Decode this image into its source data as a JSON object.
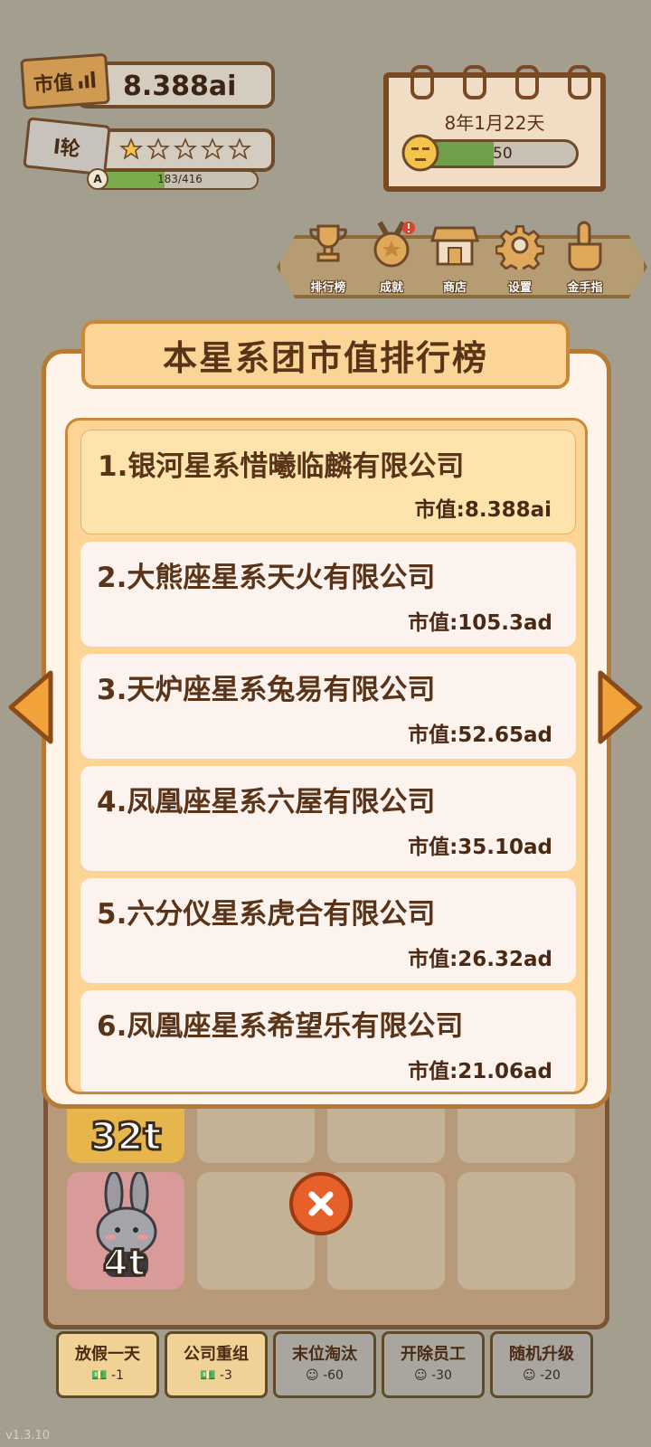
{
  "stats": {
    "market_tag": "市值",
    "market_value": "8.388ai",
    "rank_tag": "l轮",
    "stars_filled": 1,
    "stars_total": 5,
    "level_letter": "A",
    "progress_text": "183/416",
    "progress_ratio": 0.44
  },
  "calendar": {
    "date": "8年1月22天",
    "mood_value": "50",
    "mood_ratio": 0.5
  },
  "toolbar": {
    "ranking": "排行榜",
    "achievement": "成就",
    "shop": "商店",
    "settings": "设置",
    "golden_finger": "金手指"
  },
  "modal": {
    "title": "本星系团市值排行榜",
    "rows": [
      {
        "name": "1.银河星系惜曦临麟有限公司",
        "value": "市值:8.388ai"
      },
      {
        "name": "2.大熊座星系天火有限公司",
        "value": "市值:105.3ad"
      },
      {
        "name": "3.天炉座星系兔易有限公司",
        "value": "市值:52.65ad"
      },
      {
        "name": "4.凤凰座星系六屋有限公司",
        "value": "市值:35.10ad"
      },
      {
        "name": "5.六分仪星系虎合有限公司",
        "value": "市值:26.32ad"
      },
      {
        "name": "6.凤凰座星系希望乐有限公司",
        "value": "市值:21.06ad"
      }
    ]
  },
  "board": {
    "tile1_label": "32t",
    "tile2_label": "4t"
  },
  "actions": [
    {
      "label": "放假一天",
      "cost": "-1"
    },
    {
      "label": "公司重组",
      "cost": "-3"
    },
    {
      "label": "末位淘汰",
      "cost": "-60"
    },
    {
      "label": "开除员工",
      "cost": "-30"
    },
    {
      "label": "随机升级",
      "cost": "-20"
    }
  ],
  "version": "v1.3.10",
  "colors": {
    "accent_orange": "#f2a23a",
    "title_bg": "#fcd596",
    "row_bg": "#fcf2ee",
    "row_highlight": "#fee3ad",
    "close_red": "#e5602a"
  }
}
